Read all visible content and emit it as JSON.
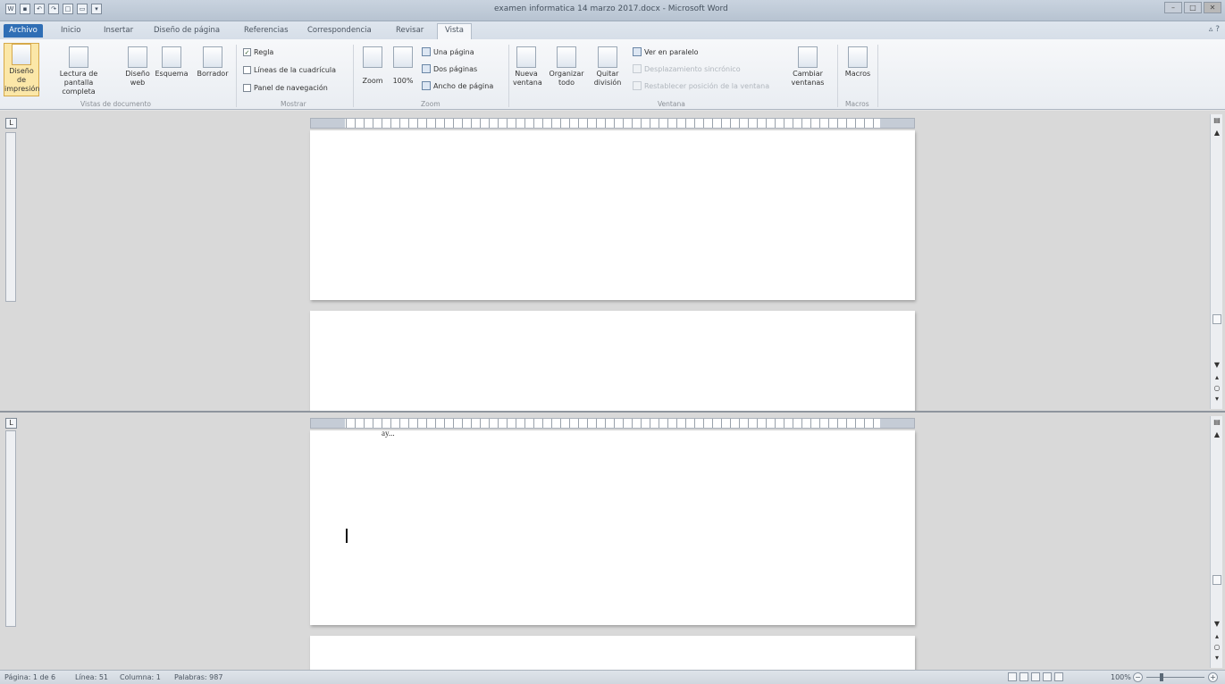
{
  "window": {
    "title": "examen informatica 14 marzo 2017.docx - Microsoft Word",
    "controls": [
      "–",
      "□",
      "✕"
    ]
  },
  "tabs": [
    {
      "label": "Archivo",
      "type": "file"
    },
    {
      "label": "Inicio"
    },
    {
      "label": "Insertar"
    },
    {
      "label": "Diseño de página"
    },
    {
      "label": "Referencias"
    },
    {
      "label": "Correspondencia"
    },
    {
      "label": "Revisar"
    },
    {
      "label": "Vista",
      "active": true
    }
  ],
  "ribbon": {
    "vistas": {
      "label": "Vistas de documento",
      "btn_print_layout": "Diseño de impresión",
      "btn_full_screen_1": "Lectura de",
      "btn_full_screen_2": "pantalla completa",
      "btn_web_layout_1": "Diseño",
      "btn_web_layout_2": "web",
      "btn_outline": "Esquema",
      "btn_draft": "Borrador"
    },
    "mostrar": {
      "label": "Mostrar",
      "regla": "Regla",
      "regla_checked": true,
      "lineas": "Líneas de la cuadrícula",
      "panel": "Panel de navegación"
    },
    "zoom": {
      "label": "Zoom",
      "btn_zoom": "Zoom",
      "btn_100": "100%",
      "una_pagina": "Una página",
      "dos_paginas": "Dos páginas",
      "ancho_pagina": "Ancho de página"
    },
    "ventana": {
      "label": "Ventana",
      "nueva_1": "Nueva",
      "nueva_2": "ventana",
      "organizar_1": "Organizar",
      "organizar_2": "todo",
      "quitar_1": "Quitar",
      "quitar_2": "división",
      "ver_paralelo": "Ver en paralelo",
      "desplazamiento": "Desplazamiento sincrónico",
      "restablecer": "Restablecer posición de la ventana",
      "cambiar_1": "Cambiar",
      "cambiar_2": "ventanas"
    },
    "macros": {
      "label": "Macros",
      "btn_macros": "Macros"
    }
  },
  "document": {
    "fragment_text": "ay..."
  },
  "statusbar": {
    "page": "Página: 1 de 6",
    "line": "Línea: 51",
    "column": "Columna: 1",
    "words": "Palabras: 987",
    "zoom": "100%"
  }
}
